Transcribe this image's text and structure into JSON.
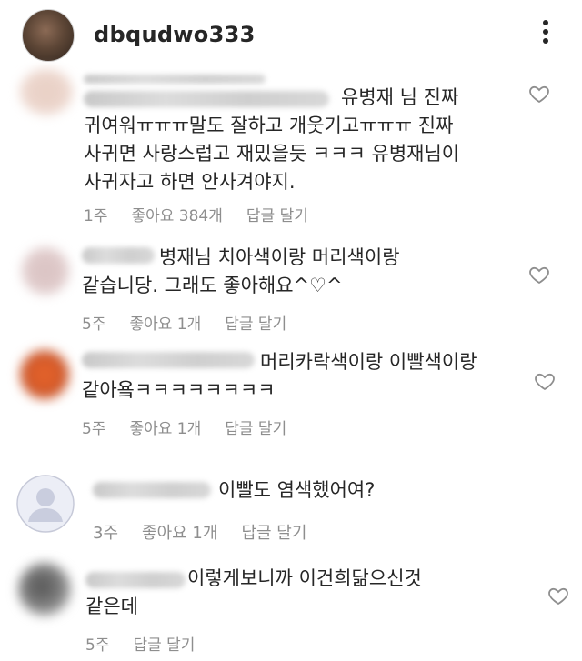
{
  "header": {
    "username": "dbqudwo333"
  },
  "comments": [
    {
      "username_hint": "@jysohaosmilesavesilver",
      "text": "유병재 님 진짜\n귀여워ㅠㅠㅠ말도 잘하고 개웃기고ㅠㅠㅠ 진짜\n사귀면 사랑스럽고 재밌을듯 ㅋㅋㅋ 유병재님이\n사귀자고 하면 안사겨야지.",
      "time": "1주",
      "likes": "좋아요 384개",
      "reply": "답글 달기"
    },
    {
      "text": "병재님 치아색이랑 머리색이랑\n같습니당. 그래도 좋아해요^♡^",
      "time": "5주",
      "likes": "좋아요 1개",
      "reply": "답글 달기"
    },
    {
      "text": "머리카락색이랑 이빨색이랑\n같아욬ㅋㅋㅋㅋㅋㅋㅋㅋ",
      "time": "5주",
      "likes": "좋아요 1개",
      "reply": "답글 달기"
    },
    {
      "text": "이빨도 염색했어여?",
      "time": "3주",
      "likes": "좋아요 1개",
      "reply": "답글 달기"
    },
    {
      "text": "이렇게보니까 이건희닮으신것\n같은데",
      "time": "5주",
      "reply": "답글 달기"
    }
  ],
  "colors": {
    "text": "#262626",
    "meta": "#8e8e8e",
    "heart": "#8e8e8e"
  }
}
